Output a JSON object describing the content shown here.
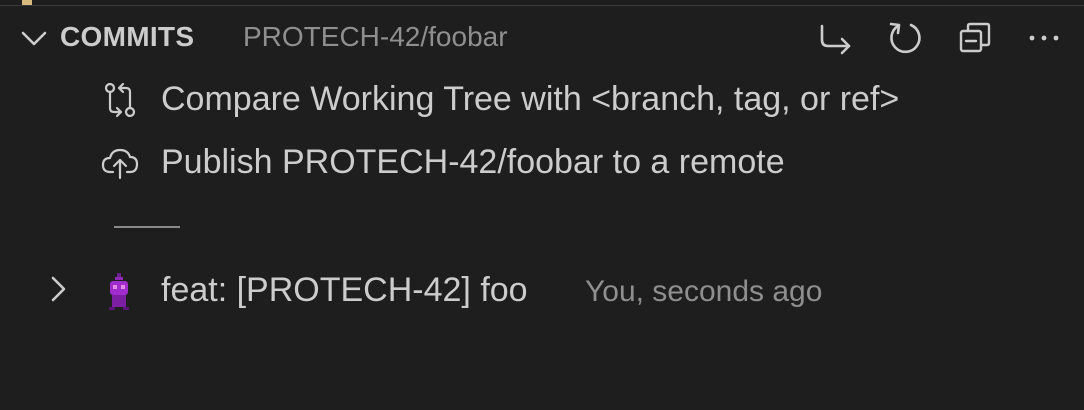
{
  "header": {
    "title": "COMMITS",
    "branch": "PROTECH-42/foobar",
    "actions": [
      {
        "name": "switch-branch",
        "icon": "arrow-redirect-icon"
      },
      {
        "name": "refresh",
        "icon": "refresh-icon"
      },
      {
        "name": "collapse-all",
        "icon": "collapse-all-icon"
      },
      {
        "name": "more",
        "icon": "ellipsis-icon"
      }
    ]
  },
  "items": {
    "compare": {
      "label": "Compare Working Tree with <branch, tag, or ref>",
      "icon": "git-compare-icon"
    },
    "publish": {
      "label": "Publish PROTECH-42/foobar to a remote",
      "icon": "cloud-upload-icon"
    },
    "commit": {
      "message": "feat: [PROTECH-42] foo",
      "meta": "You, seconds ago",
      "icon": "avatar"
    }
  },
  "colors": {
    "background": "#1e1e1e",
    "foreground": "#cccccc",
    "muted": "#8f8f8f",
    "avatar": "#a12ccd"
  }
}
